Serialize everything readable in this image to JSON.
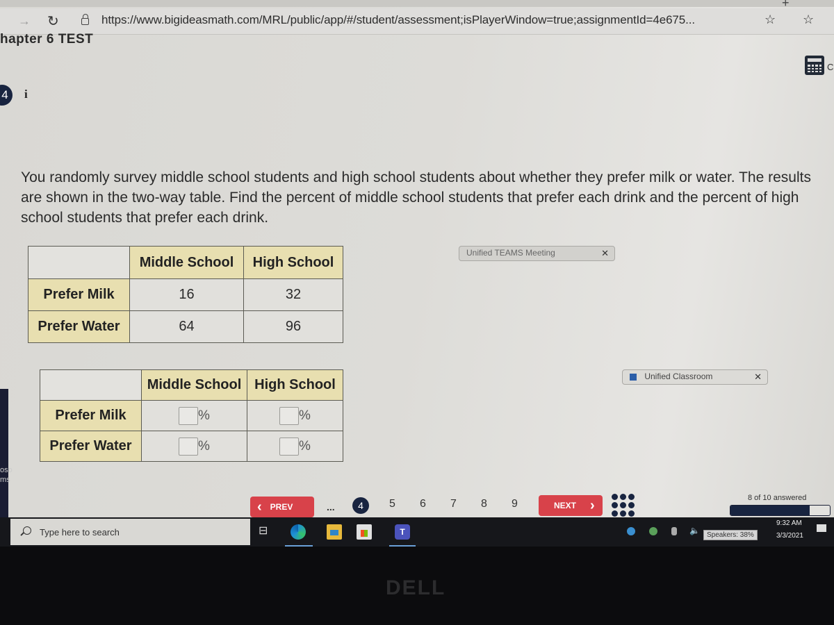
{
  "browser": {
    "tabs": [
      {
        "label": "Unified TEAMS Meeting"
      },
      {
        "label": "Unified Classroom"
      }
    ],
    "url": "https://www.bigideasmath.com/MRL/public/app/#/student/assessment;isPlayerWindow=true;assignmentId=4e675...",
    "icons": [
      "forward-icon",
      "reload-icon",
      "lock-icon",
      "add-favorite-icon",
      "favorites-icon"
    ]
  },
  "page": {
    "title": "hapter 6 TEST",
    "calculator_label": "C",
    "question_number": "4",
    "info_glyph": "i",
    "question_text": "You randomly survey middle school students and high school students about whether they prefer milk or water. The results are shown in the two-way table. Find the percent of middle school students that prefer each drink and the percent of high school students that prefer each drink."
  },
  "given_table": {
    "columns": [
      "Middle School",
      "High School"
    ],
    "rows": [
      {
        "label": "Prefer Milk",
        "values": [
          "16",
          "32"
        ]
      },
      {
        "label": "Prefer Water",
        "values": [
          "64",
          "96"
        ]
      }
    ]
  },
  "answer_table": {
    "columns": [
      "Middle School",
      "High School"
    ],
    "rows": [
      {
        "label": "Prefer Milk",
        "inputs": [
          "",
          ""
        ]
      },
      {
        "label": "Prefer Water",
        "inputs": [
          "",
          ""
        ]
      }
    ],
    "unit": "%"
  },
  "navigation": {
    "prev_label": "PREV",
    "next_label": "NEXT",
    "ellipsis": "...",
    "current_page": "4",
    "pages": [
      "5",
      "6",
      "7",
      "8",
      "9"
    ],
    "answered_text": "8 of 10 answered",
    "answered_fraction": 0.8
  },
  "taskbar": {
    "search_placeholder": "Type here to search",
    "time": "9:32 AM",
    "date": "3/3/2021",
    "speakers_tooltip": "Speakers: 38%",
    "teams_glyph": "T"
  },
  "left_edge_text": [
    "oso",
    "ms"
  ],
  "hardware": {
    "logo": "DELL"
  },
  "colors": {
    "accent_red": "#d8424a",
    "navy": "#182440",
    "table_header": "#e8dfb0"
  }
}
